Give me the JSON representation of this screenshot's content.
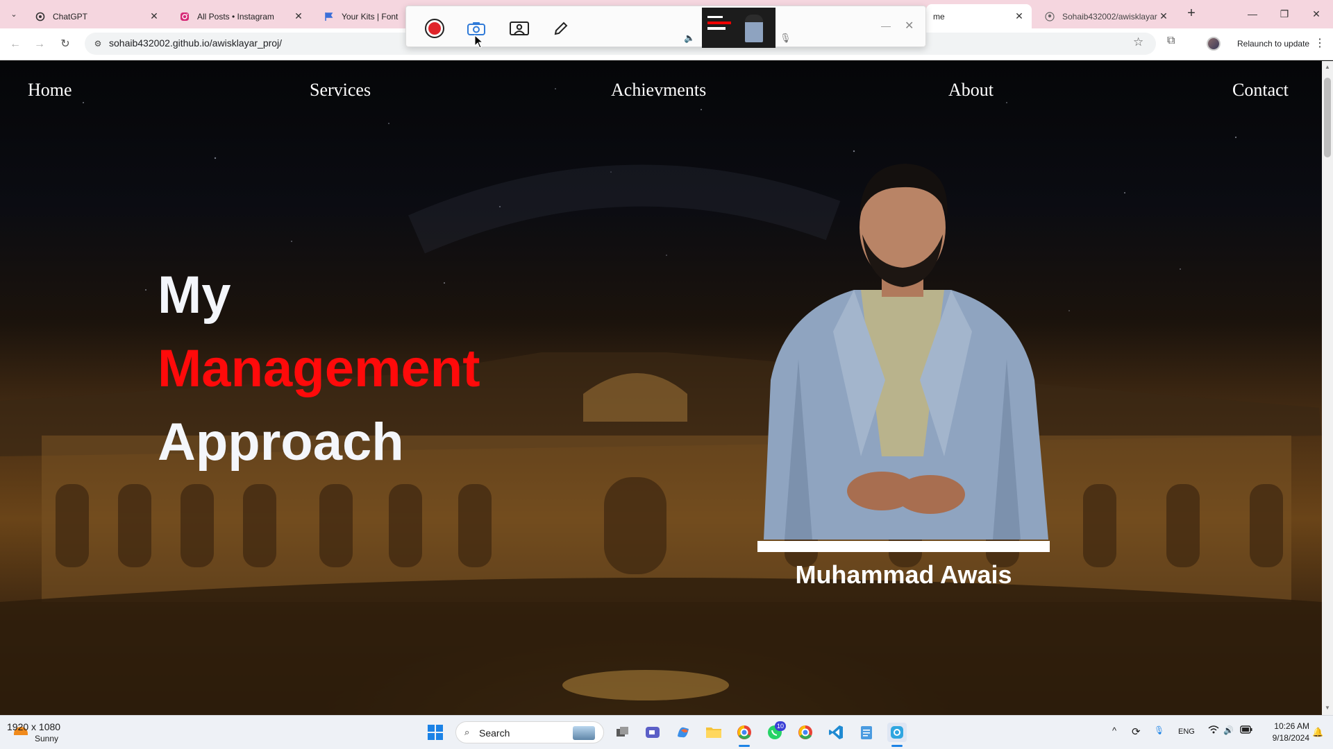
{
  "browser": {
    "tabs": [
      {
        "title": "ChatGPT",
        "icon": "chatgpt-icon"
      },
      {
        "title": "All Posts • Instagram",
        "icon": "instagram-icon"
      },
      {
        "title": "Your Kits | Font Av",
        "icon": "fontawesome-flag-icon"
      },
      {
        "title": "me",
        "icon": "page-icon"
      },
      {
        "title": "Sohaib432002/awisklayar",
        "icon": "github-icon"
      }
    ],
    "url": "sohaib432002.github.io/awisklayar_proj/",
    "relaunch_label": "Relaunch to update"
  },
  "site": {
    "nav": [
      "Home",
      "Services",
      "Achievments",
      "About",
      "Contact"
    ],
    "hero": {
      "line1": "My",
      "line2": "Management",
      "line3": "Approach"
    },
    "person_name": "Muhammad Awais",
    "colors": {
      "accent": "#ff0a0a",
      "text": "#ffffff"
    }
  },
  "taskbar": {
    "weather_top": "1920 x 1080",
    "weather_bottom": "Sunny",
    "search_label": "Search",
    "language": "ENG",
    "time": "10:26 AM",
    "date": "9/18/2024",
    "whatsapp_badge": "10"
  }
}
